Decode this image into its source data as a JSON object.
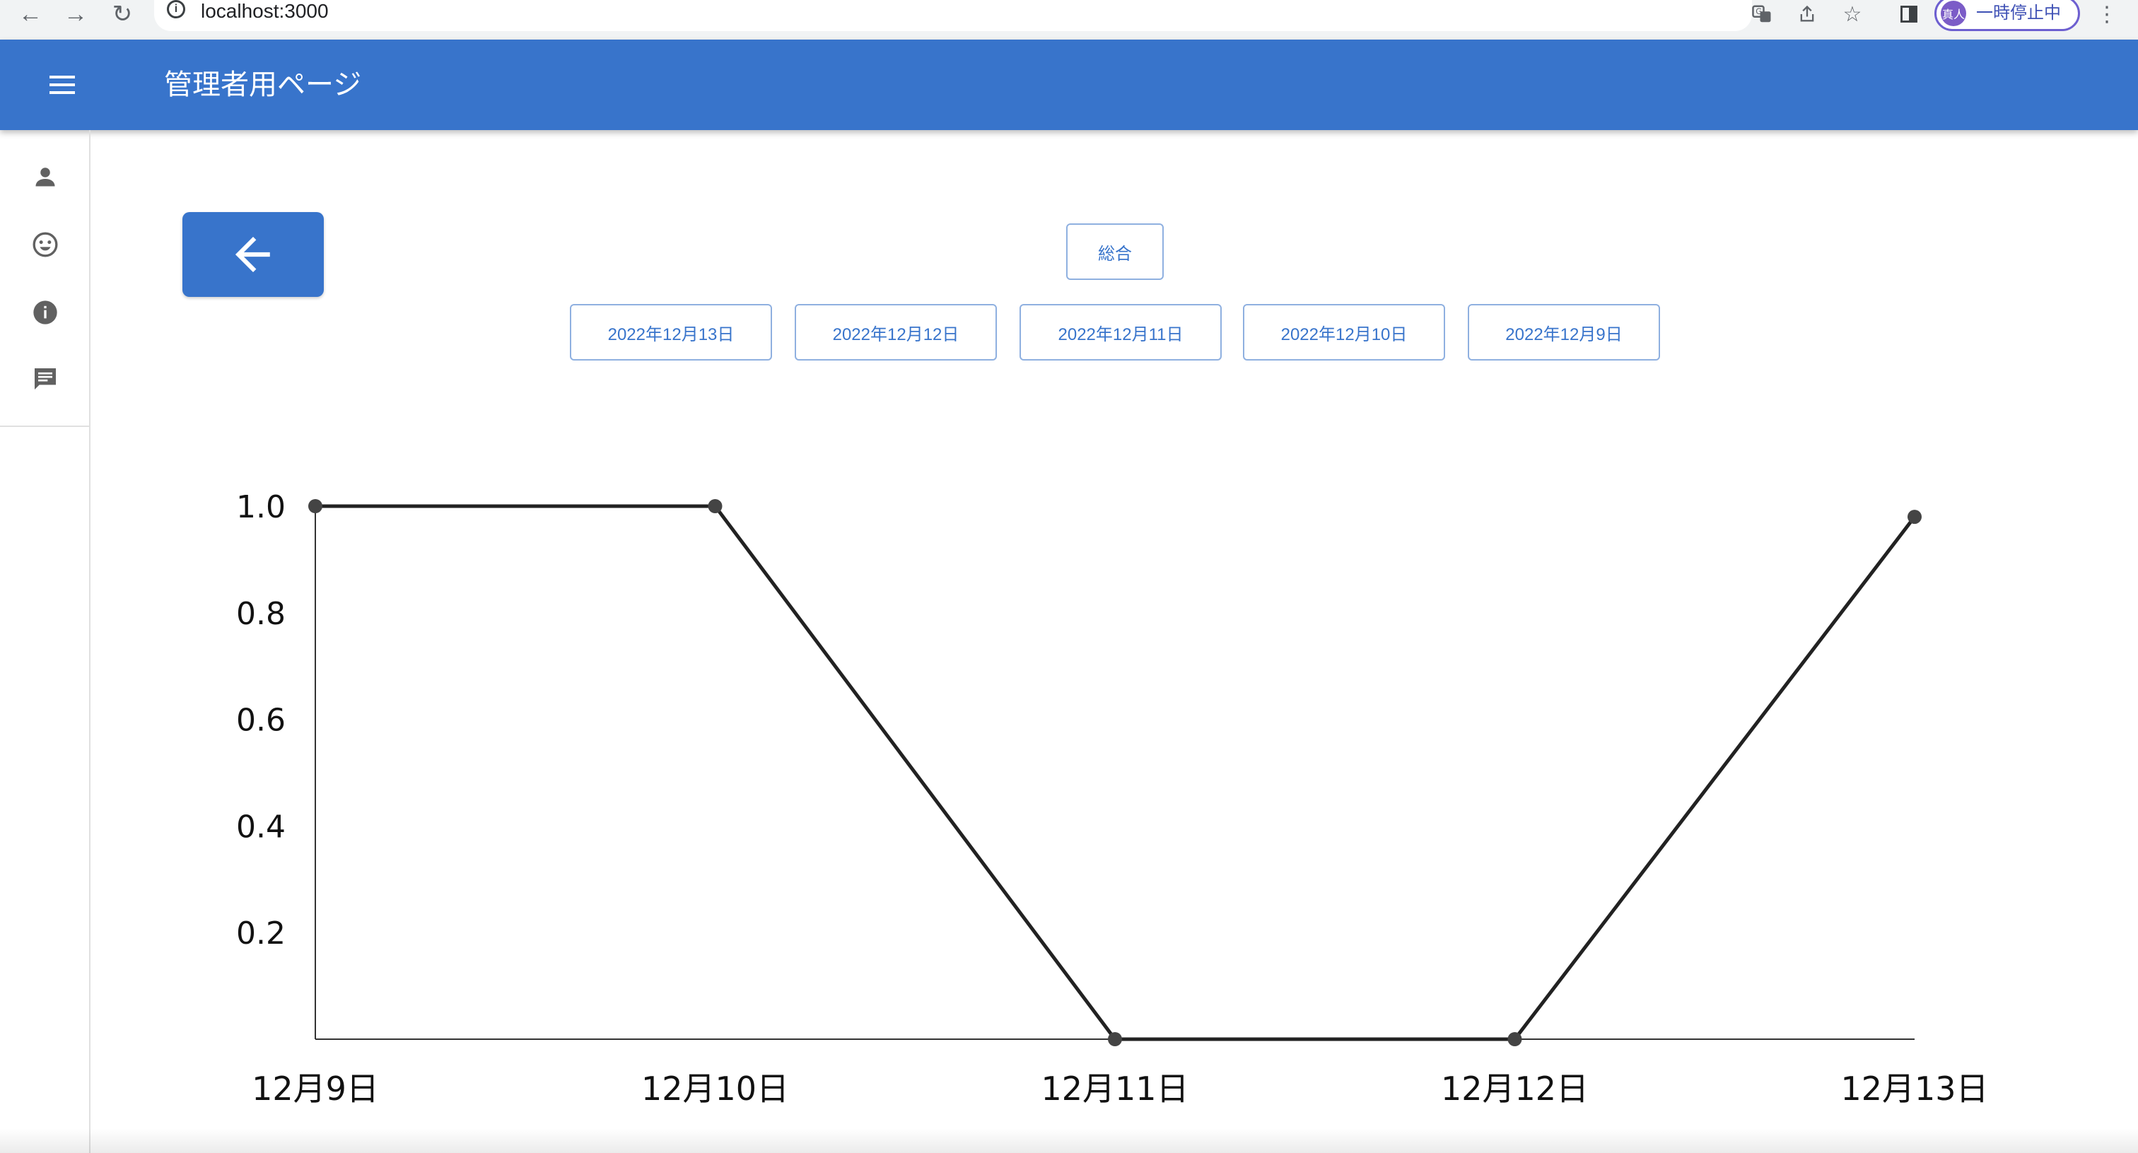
{
  "browser": {
    "url": "localhost:3000",
    "profile_avatar": "真人",
    "profile_status": "一時停止中",
    "icons": [
      "back-icon",
      "forward-icon",
      "reload-icon",
      "info-icon",
      "translate-icon",
      "share-icon",
      "star-icon",
      "sidepanel-icon",
      "more-icon"
    ]
  },
  "appbar": {
    "title": "管理者用ページ"
  },
  "sidebar": {
    "items": [
      {
        "icon": "person-icon"
      },
      {
        "icon": "smiley-icon"
      },
      {
        "icon": "info-icon"
      },
      {
        "icon": "chat-icon"
      }
    ]
  },
  "buttons": {
    "total": "総合",
    "dates": [
      "2022年12月13日",
      "2022年12月12日",
      "2022年12月11日",
      "2022年12月10日",
      "2022年12月9日"
    ]
  },
  "chart_data": {
    "type": "line",
    "categories": [
      "12月9日",
      "12月10日",
      "12月11日",
      "12月12日",
      "12月13日"
    ],
    "values": [
      1.0,
      1.0,
      0.0,
      0.0,
      0.98
    ],
    "yticks": [
      "0.2",
      "0.4",
      "0.6",
      "0.8",
      "1.0"
    ],
    "ylim": [
      0,
      1.0
    ],
    "grid": false,
    "colors": {
      "line": "#222222",
      "point": "#444444"
    }
  }
}
